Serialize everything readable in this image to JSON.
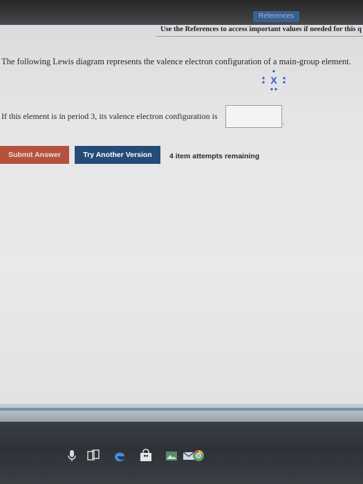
{
  "header": {
    "references_label": "References",
    "reference_note": "Use the References to access important values if needed for this q"
  },
  "question": {
    "prompt": "The following Lewis diagram represents the valence electron configuration of a main-group element.",
    "lewis_symbol": "X",
    "text": "If this element is in period 3, its valence electron configuration is",
    "answer_value": "",
    "trailing": "."
  },
  "actions": {
    "submit_label": "Submit Answer",
    "try_label": "Try Another Version",
    "attempts_text": "4 item attempts remaining"
  },
  "colors": {
    "submit_bg": "#b5523e",
    "try_bg": "#254b78",
    "references_bg": "#3a5f8f"
  },
  "taskbar_icons": [
    "microphone-icon",
    "task-view-icon",
    "edge-browser-icon",
    "store-icon",
    "photos-icon",
    "mail-icon",
    "chrome-icon"
  ]
}
